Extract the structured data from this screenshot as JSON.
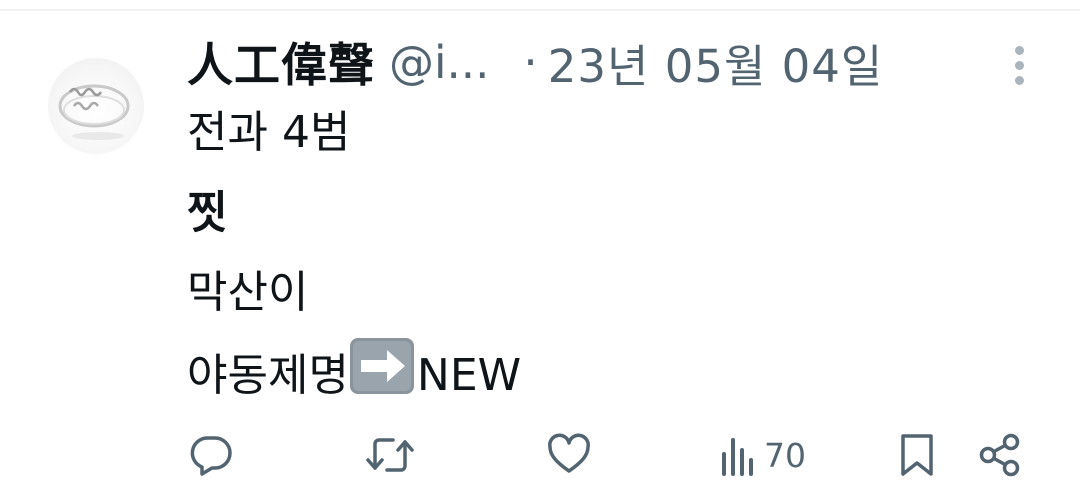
{
  "tweet": {
    "author": {
      "display_name": "人工偉聲",
      "handle": "@i...",
      "avatar_icon": "ring-avatar"
    },
    "separator": "·",
    "date": "23년 05월 04일",
    "lines": [
      "전과 4범",
      "찟",
      "막산이",
      "야동제명"
    ],
    "arrow_emoji_icon": "right-arrow-emoji",
    "last_line_suffix": "NEW"
  },
  "actions": {
    "reply_icon": "reply-icon",
    "retweet_icon": "retweet-icon",
    "like_icon": "heart-icon",
    "views_icon": "views-chart-icon",
    "views_count": "70",
    "bookmark_icon": "bookmark-icon",
    "share_icon": "share-icon"
  },
  "colors": {
    "text_primary": "#0f1419",
    "text_secondary": "#536471",
    "icon": "#536471",
    "divider": "#eff3f4"
  }
}
